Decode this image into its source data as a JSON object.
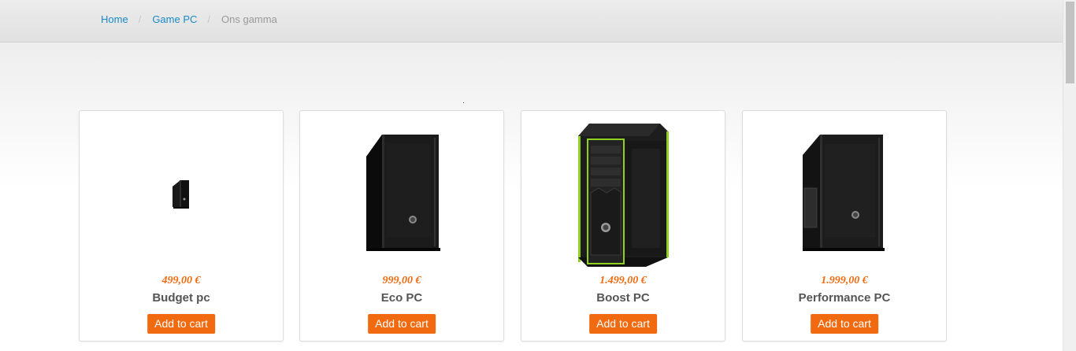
{
  "breadcrumb": {
    "items": [
      "Home",
      "Game PC"
    ],
    "separator": "/",
    "current": "Ons gamma"
  },
  "products": [
    {
      "name": "Budget pc",
      "price": "499,00 €",
      "button": "Add to cart",
      "image_icon": "pc-case-small-icon"
    },
    {
      "name": "Eco PC",
      "price": "999,00 €",
      "button": "Add to cart",
      "image_icon": "pc-case-icon"
    },
    {
      "name": "Boost PC",
      "price": "1.499,00 €",
      "button": "Add to cart",
      "image_icon": "pc-case-green-icon"
    },
    {
      "name": "Performance PC",
      "price": "1.999,00 €",
      "button": "Add to cart",
      "image_icon": "pc-case-window-icon"
    }
  ],
  "colors": {
    "link": "#1a8ac6",
    "accent": "#f26a10",
    "case_trim": "#8fd11e"
  }
}
